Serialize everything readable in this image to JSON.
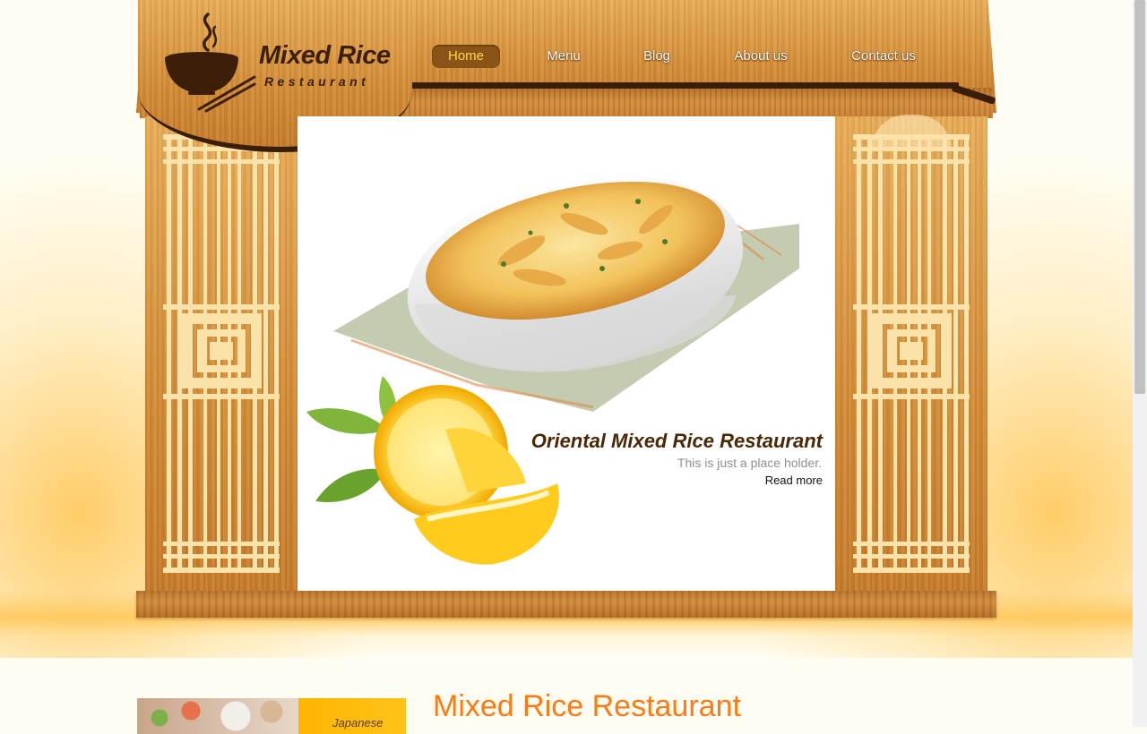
{
  "brand": {
    "name": "Mixed Rice",
    "tagline": "Restaurant",
    "logo_icon": "rice-bowl-chopsticks-icon",
    "text_color": "#3b1f08"
  },
  "nav": {
    "items": [
      {
        "label": "Home",
        "active": true
      },
      {
        "label": "Menu",
        "active": false
      },
      {
        "label": "Blog",
        "active": false
      },
      {
        "label": "About us",
        "active": false
      },
      {
        "label": "Contact us",
        "active": false
      }
    ],
    "active_color": "#ffd84a"
  },
  "slider": {
    "title": "Oriental Mixed Rice Restaurant",
    "text": "This is just a place holder.",
    "link": "Read more"
  },
  "content": {
    "thumbnail_label": "Japanese",
    "section_title": "Mixed Rice Restaurant",
    "title_color": "#ff7a10"
  }
}
